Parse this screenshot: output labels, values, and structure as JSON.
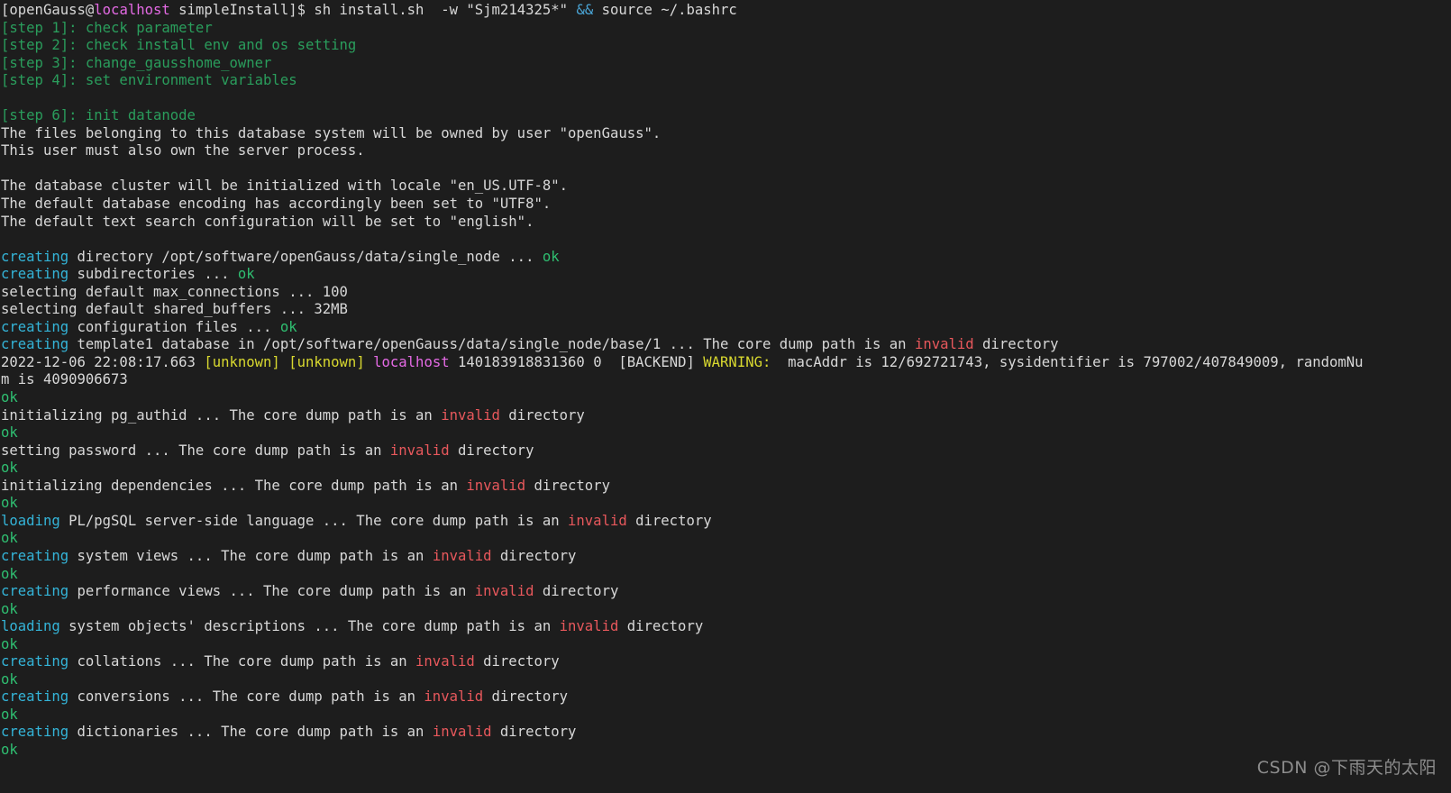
{
  "terminal": {
    "background_color": "#1d1d1d",
    "foreground_color": "#d8d8d8",
    "palette": {
      "ok_green": "#2fbf71",
      "step_green": "#2a9d5c",
      "creating_cyan": "#34b4d8",
      "operator_blue": "#4aa5d6",
      "host_magenta": "#e46ae4",
      "warning_yellow": "#d8d82f",
      "invalid_red": "#e8585c"
    },
    "prompt": {
      "user": "openGauss",
      "at": "@",
      "host": "localhost",
      "cwd": "simpleInstall",
      "bracket_open": "[",
      "bracket_close": "]$ ",
      "command_part1": "sh install.sh  -w \"Sjm214325*\" ",
      "command_operator": "&&",
      "command_part2": " source ~/.bashrc"
    },
    "lines": [
      {
        "id": "prompt",
        "type": "prompt"
      },
      {
        "id": "step1",
        "type": "plain",
        "segments": [
          {
            "color": "dgreen",
            "text": "[step 1]: check parameter"
          }
        ]
      },
      {
        "id": "step2",
        "type": "plain",
        "segments": [
          {
            "color": "dgreen",
            "text": "[step 2]: check install env and os setting"
          }
        ]
      },
      {
        "id": "step3",
        "type": "plain",
        "segments": [
          {
            "color": "dgreen",
            "text": "[step 3]: change_gausshome_owner"
          }
        ]
      },
      {
        "id": "step4",
        "type": "plain",
        "segments": [
          {
            "color": "dgreen",
            "text": "[step 4]: set environment variables"
          }
        ]
      },
      {
        "id": "blank1",
        "type": "plain",
        "segments": [
          {
            "color": "white",
            "text": ""
          }
        ]
      },
      {
        "id": "step6",
        "type": "plain",
        "segments": [
          {
            "color": "dgreen",
            "text": "[step 6]: init datanode"
          }
        ]
      },
      {
        "id": "owner1",
        "type": "plain",
        "segments": [
          {
            "color": "white",
            "text": "The files belonging to this database system will be owned by user \"openGauss\"."
          }
        ]
      },
      {
        "id": "owner2",
        "type": "plain",
        "segments": [
          {
            "color": "white",
            "text": "This user must also own the server process."
          }
        ]
      },
      {
        "id": "blank2",
        "type": "plain",
        "segments": [
          {
            "color": "white",
            "text": ""
          }
        ]
      },
      {
        "id": "locale",
        "type": "plain",
        "segments": [
          {
            "color": "white",
            "text": "The database cluster will be initialized with locale \"en_US.UTF-8\"."
          }
        ]
      },
      {
        "id": "encoding",
        "type": "plain",
        "segments": [
          {
            "color": "white",
            "text": "The default database encoding has accordingly been set to \"UTF8\"."
          }
        ]
      },
      {
        "id": "textsearch",
        "type": "plain",
        "segments": [
          {
            "color": "white",
            "text": "The default text search configuration will be set to \"english\"."
          }
        ]
      },
      {
        "id": "blank3",
        "type": "plain",
        "segments": [
          {
            "color": "white",
            "text": ""
          }
        ]
      },
      {
        "id": "creatingdir",
        "type": "plain",
        "segments": [
          {
            "color": "cyan",
            "text": "creating"
          },
          {
            "color": "white",
            "text": " directory /opt/software/openGauss/data/single_node ... "
          },
          {
            "color": "green",
            "text": "ok"
          }
        ]
      },
      {
        "id": "creatingsub",
        "type": "plain",
        "segments": [
          {
            "color": "cyan",
            "text": "creating"
          },
          {
            "color": "white",
            "text": " subdirectories ... "
          },
          {
            "color": "green",
            "text": "ok"
          }
        ]
      },
      {
        "id": "maxconn",
        "type": "plain",
        "segments": [
          {
            "color": "white",
            "text": "selecting default max_connections ... 100"
          }
        ]
      },
      {
        "id": "sharedbuf",
        "type": "plain",
        "segments": [
          {
            "color": "white",
            "text": "selecting default shared_buffers ... 32MB"
          }
        ]
      },
      {
        "id": "creatingconf",
        "type": "plain",
        "segments": [
          {
            "color": "cyan",
            "text": "creating"
          },
          {
            "color": "white",
            "text": " configuration files ... "
          },
          {
            "color": "green",
            "text": "ok"
          }
        ]
      },
      {
        "id": "template1",
        "type": "plain",
        "segments": [
          {
            "color": "cyan",
            "text": "creating"
          },
          {
            "color": "white",
            "text": " template1 database in /opt/software/openGauss/data/single_node/base/1 ... The core dump path is an "
          },
          {
            "color": "red",
            "text": "invalid"
          },
          {
            "color": "white",
            "text": " directory"
          }
        ]
      },
      {
        "id": "warning",
        "type": "plain",
        "segments": [
          {
            "color": "white",
            "text": "2022-12-06 22:08:17.663 "
          },
          {
            "color": "yellow",
            "text": "[unknown]"
          },
          {
            "color": "white",
            "text": " "
          },
          {
            "color": "yellow",
            "text": "[unknown]"
          },
          {
            "color": "white",
            "text": " "
          },
          {
            "color": "magenta",
            "text": "localhost"
          },
          {
            "color": "white",
            "text": " 140183918831360 0  [BACKEND] "
          },
          {
            "color": "yellow",
            "text": "WARNING:"
          },
          {
            "color": "white",
            "text": "  macAddr is 12/692721743, sysidentifier is 797002/407849009, randomNu"
          }
        ]
      },
      {
        "id": "warningwrap",
        "type": "plain",
        "segments": [
          {
            "color": "white",
            "text": "m is 4090906673"
          }
        ]
      },
      {
        "id": "ok1",
        "type": "plain",
        "segments": [
          {
            "color": "green",
            "text": "ok"
          }
        ]
      },
      {
        "id": "pgauthid",
        "type": "plain",
        "segments": [
          {
            "color": "white",
            "text": "initializing pg_authid ... The core dump path is an "
          },
          {
            "color": "red",
            "text": "invalid"
          },
          {
            "color": "white",
            "text": " directory"
          }
        ]
      },
      {
        "id": "ok2",
        "type": "plain",
        "segments": [
          {
            "color": "green",
            "text": "ok"
          }
        ]
      },
      {
        "id": "setpassword",
        "type": "plain",
        "segments": [
          {
            "color": "white",
            "text": "setting password ... The core dump path is an "
          },
          {
            "color": "red",
            "text": "invalid"
          },
          {
            "color": "white",
            "text": " directory"
          }
        ]
      },
      {
        "id": "ok3",
        "type": "plain",
        "segments": [
          {
            "color": "green",
            "text": "ok"
          }
        ]
      },
      {
        "id": "deps",
        "type": "plain",
        "segments": [
          {
            "color": "white",
            "text": "initializing dependencies ... The core dump path is an "
          },
          {
            "color": "red",
            "text": "invalid"
          },
          {
            "color": "white",
            "text": " directory"
          }
        ]
      },
      {
        "id": "ok4",
        "type": "plain",
        "segments": [
          {
            "color": "green",
            "text": "ok"
          }
        ]
      },
      {
        "id": "plpgsql",
        "type": "plain",
        "segments": [
          {
            "color": "cyan",
            "text": "loading"
          },
          {
            "color": "white",
            "text": " PL/pgSQL server-side language ... The core dump path is an "
          },
          {
            "color": "red",
            "text": "invalid"
          },
          {
            "color": "white",
            "text": " directory"
          }
        ]
      },
      {
        "id": "ok5",
        "type": "plain",
        "segments": [
          {
            "color": "green",
            "text": "ok"
          }
        ]
      },
      {
        "id": "sysviews",
        "type": "plain",
        "segments": [
          {
            "color": "cyan",
            "text": "creating"
          },
          {
            "color": "white",
            "text": " system views ... The core dump path is an "
          },
          {
            "color": "red",
            "text": "invalid"
          },
          {
            "color": "white",
            "text": " directory"
          }
        ]
      },
      {
        "id": "ok6",
        "type": "plain",
        "segments": [
          {
            "color": "green",
            "text": "ok"
          }
        ]
      },
      {
        "id": "perfviews",
        "type": "plain",
        "segments": [
          {
            "color": "cyan",
            "text": "creating"
          },
          {
            "color": "white",
            "text": " performance views ... The core dump path is an "
          },
          {
            "color": "red",
            "text": "invalid"
          },
          {
            "color": "white",
            "text": " directory"
          }
        ]
      },
      {
        "id": "ok7",
        "type": "plain",
        "segments": [
          {
            "color": "green",
            "text": "ok"
          }
        ]
      },
      {
        "id": "sysobjdesc",
        "type": "plain",
        "segments": [
          {
            "color": "cyan",
            "text": "loading"
          },
          {
            "color": "white",
            "text": " system objects' descriptions ... The core dump path is an "
          },
          {
            "color": "red",
            "text": "invalid"
          },
          {
            "color": "white",
            "text": " directory"
          }
        ]
      },
      {
        "id": "ok8",
        "type": "plain",
        "segments": [
          {
            "color": "green",
            "text": "ok"
          }
        ]
      },
      {
        "id": "collations",
        "type": "plain",
        "segments": [
          {
            "color": "cyan",
            "text": "creating"
          },
          {
            "color": "white",
            "text": " collations ... The core dump path is an "
          },
          {
            "color": "red",
            "text": "invalid"
          },
          {
            "color": "white",
            "text": " directory"
          }
        ]
      },
      {
        "id": "ok9",
        "type": "plain",
        "segments": [
          {
            "color": "green",
            "text": "ok"
          }
        ]
      },
      {
        "id": "conversions",
        "type": "plain",
        "segments": [
          {
            "color": "cyan",
            "text": "creating"
          },
          {
            "color": "white",
            "text": " conversions ... The core dump path is an "
          },
          {
            "color": "red",
            "text": "invalid"
          },
          {
            "color": "white",
            "text": " directory"
          }
        ]
      },
      {
        "id": "ok10",
        "type": "plain",
        "segments": [
          {
            "color": "green",
            "text": "ok"
          }
        ]
      },
      {
        "id": "dictionaries",
        "type": "plain",
        "segments": [
          {
            "color": "cyan",
            "text": "creating"
          },
          {
            "color": "white",
            "text": " dictionaries ... The core dump path is an "
          },
          {
            "color": "red",
            "text": "invalid"
          },
          {
            "color": "white",
            "text": " directory"
          }
        ]
      },
      {
        "id": "ok11",
        "type": "plain",
        "segments": [
          {
            "color": "green",
            "text": "ok"
          }
        ]
      }
    ]
  },
  "watermark": {
    "text": "CSDN @下雨天的太阳"
  }
}
